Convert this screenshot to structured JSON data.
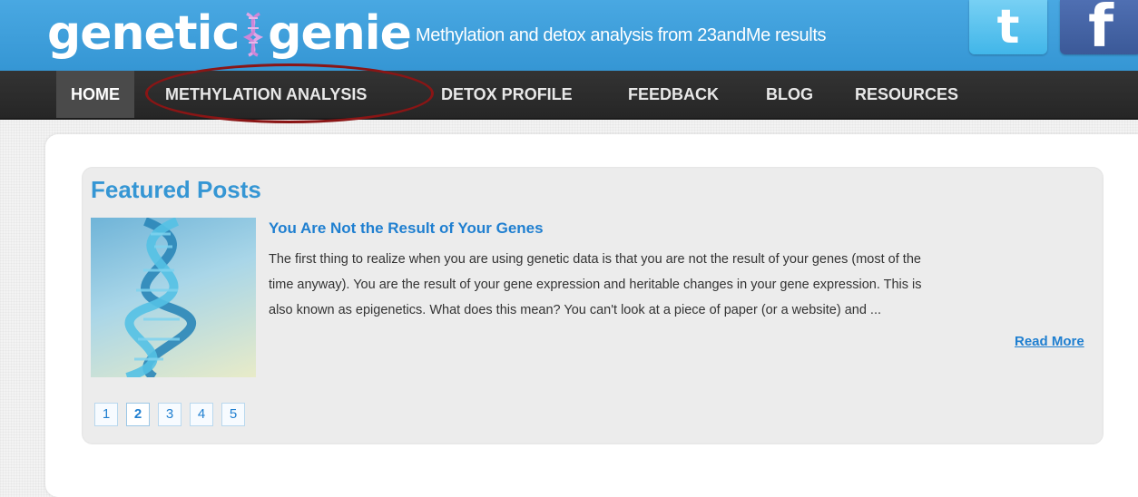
{
  "header": {
    "logo_left": "genetic",
    "logo_right": "genie",
    "tagline": "Methylation and detox analysis from 23andMe results",
    "social": [
      {
        "name": "twitter",
        "glyph": "t"
      },
      {
        "name": "facebook",
        "glyph": "f"
      }
    ]
  },
  "nav": {
    "items": [
      {
        "label": "HOME",
        "active": true
      },
      {
        "label": "METHYLATION ANALYSIS",
        "active": false,
        "highlighted": true
      },
      {
        "label": "DETOX PROFILE",
        "active": false
      },
      {
        "label": "FEEDBACK",
        "active": false
      },
      {
        "label": "BLOG",
        "active": false
      },
      {
        "label": "RESOURCES",
        "active": false
      }
    ]
  },
  "featured": {
    "heading": "Featured Posts",
    "post": {
      "title": "You Are Not the Result of Your Genes",
      "excerpt_lines": [
        "The first thing to realize when you are using genetic data is that you are not the result of your genes (most of the",
        "time anyway). You are the result of your gene expression and heritable changes in your gene expression. This is",
        "also known as epigenetics. What does this mean? You can't look at a piece of paper (or a website) and ..."
      ],
      "read_more": "Read More",
      "image_icon": "dna-helix-icon"
    },
    "pagination": {
      "pages": [
        "1",
        "2",
        "3",
        "4",
        "5"
      ],
      "current": "2"
    }
  },
  "colors": {
    "header_blue": "#3ca0dc",
    "nav_dark": "#2d2d2d",
    "link_blue": "#1f7fd0",
    "highlight_ring": "#8a1515"
  }
}
